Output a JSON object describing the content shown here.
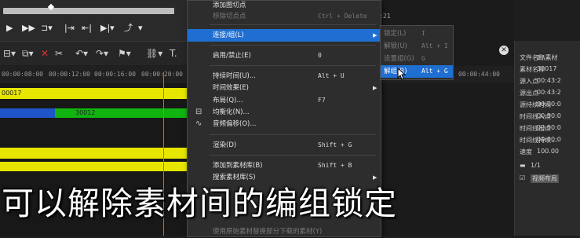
{
  "timeline": {
    "timecodes": [
      "00:00:08:00",
      "00:00:12:00",
      "00:00:16:00",
      "00:00:20:00"
    ],
    "mid_timecode": "00:00:44:00",
    "clip1_label": "00017",
    "clip2_label": "30012",
    "top_readout": ":21"
  },
  "menu": {
    "items": [
      {
        "label": "添加图切点",
        "shortcut": "",
        "dim": false
      },
      {
        "label": "移除切点点",
        "shortcut": "Ctrl + Delete",
        "dim": true
      },
      {
        "label": "连接/组(L)",
        "shortcut": "",
        "highlight": true,
        "submenu": true
      },
      {
        "label": "启用/禁止(E)",
        "shortcut": "0"
      },
      {
        "label": "持续时间(U)...",
        "shortcut": "Alt + U"
      },
      {
        "label": "时间效果(E)",
        "shortcut": "",
        "submenu": true
      },
      {
        "label": "布局(Q)...",
        "shortcut": "F7"
      },
      {
        "label": "均衡化(N)...",
        "shortcut": ""
      },
      {
        "label": "音频偏移(O)...",
        "shortcut": ""
      },
      {
        "label": "渲染(D)",
        "shortcut": "Shift + G"
      },
      {
        "label": "添加到素材库(B)",
        "shortcut": "Shift + B"
      },
      {
        "label": "搜索素材库(S)",
        "shortcut": "",
        "submenu": true
      },
      {
        "label": "使用原始素材替换部分下载的素材(Y)",
        "shortcut": "",
        "dim": true
      }
    ]
  },
  "submenu": {
    "items": [
      {
        "label": "锁定(L)",
        "shortcut": "I"
      },
      {
        "label": "解锁(U)",
        "shortcut": "Alt + I"
      },
      {
        "label": "设置组(G)",
        "shortcut": "G"
      },
      {
        "label": "解组(R)",
        "shortcut": "Alt + G",
        "highlight": true
      }
    ]
  },
  "properties": {
    "rows": [
      {
        "label": "文件名称",
        "value": "E:\\素材"
      },
      {
        "label": "素材名称",
        "value": "30017"
      },
      {
        "label": "源入点",
        "value": "00:43:2"
      },
      {
        "label": "源出点",
        "value": "00:43:2"
      },
      {
        "label": "源持续时间",
        "value": "00:00:0"
      },
      {
        "label": "时间线入点",
        "value": "00:00:0"
      },
      {
        "label": "时间线出点",
        "value": "00:00:0"
      },
      {
        "label": "时间线持续...",
        "value": "00:00:0"
      },
      {
        "label": "速度",
        "value": "100.00"
      }
    ],
    "page": "1/1",
    "tag": "视频布局"
  },
  "caption": "可以解除素材间的编组锁定",
  "colors": {
    "highlight": "#1f6ed1",
    "clip_yellow": "#e6e600",
    "clip_green": "#11b311",
    "clip_blue": "#1f55c8"
  }
}
